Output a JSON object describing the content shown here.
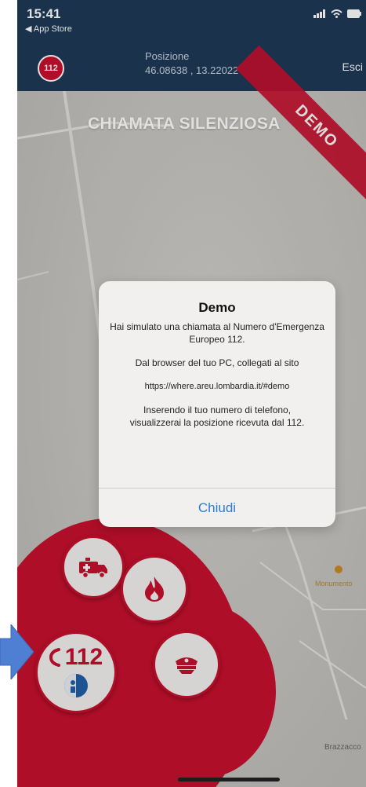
{
  "status_bar": {
    "time": "15:41",
    "back_label": "◀ App Store"
  },
  "header": {
    "logo_text": "112",
    "position_label": "Posizione",
    "position_value": "46.08638 , 13.22022",
    "exit_label": "Esci"
  },
  "map": {
    "place_label": "Brazzacco",
    "poi_label": "Monumento"
  },
  "title": "CHIAMATA SILENZIOSA",
  "ribbon_label": "DEMO",
  "dialog": {
    "title": "Demo",
    "line1": "Hai simulato una chiamata al Numero d'Emergenza Europeo 112.",
    "line2": "Dal browser del tuo PC, collegati al sito",
    "line3": "https://where.areu.lombardia.it/#demo",
    "line4": "Inserendo il tuo numero di telefono, visualizzerai la posizione ricevuta dal 112.",
    "button_label": "Chiudi"
  },
  "actions": {
    "emergency_number": "112",
    "icons": [
      "ambulance-icon",
      "fire-icon",
      "phone-icon",
      "police-icon",
      "info-icon"
    ]
  },
  "colors": {
    "header_bg": "#1e3a57",
    "brand_red": "#c8102e",
    "dialog_button": "#2b7bd6",
    "arrow_blue": "#4f7fd3"
  }
}
